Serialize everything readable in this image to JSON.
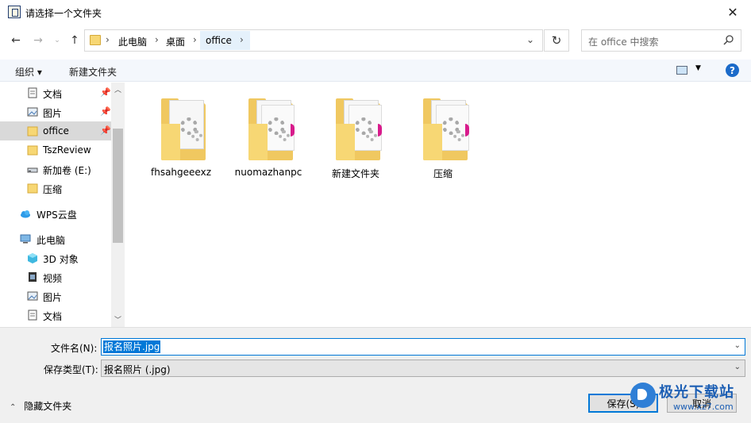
{
  "window": {
    "title": "请选择一个文件夹",
    "close_glyph": "✕"
  },
  "nav": {
    "breadcrumbs": [
      "此电脑",
      "桌面",
      "office"
    ],
    "separator": "›",
    "search_placeholder": "在 office 中搜索"
  },
  "toolbar": {
    "organize": "组织 ▾",
    "new_folder": "新建文件夹",
    "help": "?"
  },
  "sidebar": {
    "items": [
      {
        "label": "文档",
        "icon": "document-icon",
        "pinned": true
      },
      {
        "label": "图片",
        "icon": "picture-icon",
        "pinned": true
      },
      {
        "label": "office",
        "icon": "folder-icon",
        "pinned": true,
        "selected": true
      },
      {
        "label": "TszReview",
        "icon": "folder-icon"
      },
      {
        "label": "新加卷 (E:)",
        "icon": "drive-icon"
      },
      {
        "label": "压缩",
        "icon": "folder-icon"
      },
      {
        "label": "WPS云盘",
        "icon": "cloud-icon"
      },
      {
        "label": "此电脑",
        "icon": "computer-icon"
      },
      {
        "label": "3D 对象",
        "icon": "cube-icon"
      },
      {
        "label": "视频",
        "icon": "video-icon"
      },
      {
        "label": "图片",
        "icon": "picture-icon"
      },
      {
        "label": "文档",
        "icon": "document-icon"
      }
    ]
  },
  "folders": [
    {
      "name": "fhsahgeeexz",
      "variant": "gear"
    },
    {
      "name": "nuomazhanpc",
      "variant": "pink"
    },
    {
      "name": "新建文件夹",
      "variant": "pink"
    },
    {
      "name": "压缩",
      "variant": "pink"
    }
  ],
  "form": {
    "filename_label": "文件名(N):",
    "filename_value": "报名照片.jpg",
    "filetype_label": "保存类型(T):",
    "filetype_value": "报名照片 (.jpg)",
    "hide_folders": "隐藏文件夹",
    "save_button": "保存(S)",
    "cancel_button": "取消"
  },
  "watermark": {
    "text": "极光下载站",
    "url": "www.xz7.com"
  },
  "colors": {
    "accent": "#0078d7",
    "folder": "#f0c860",
    "help": "#1b6ac9"
  }
}
